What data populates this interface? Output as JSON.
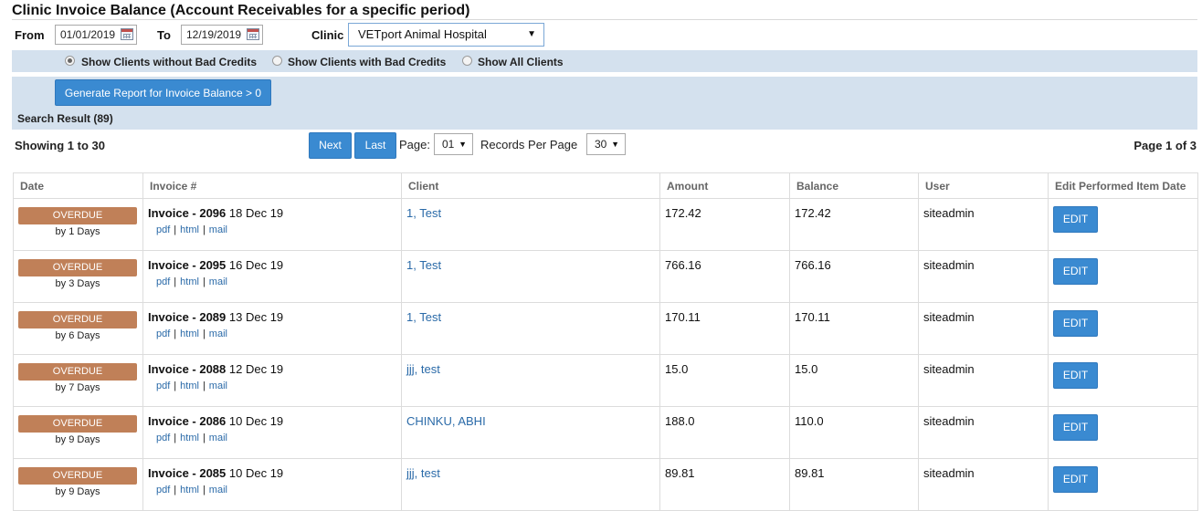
{
  "page": {
    "title": "Clinic Invoice Balance (Account Receivables for a specific period)"
  },
  "filters": {
    "from_label": "From",
    "from_value": "01/01/2019",
    "to_label": "To",
    "to_value": "12/19/2019",
    "clinic_label": "Clinic",
    "clinic_value": "VETport Animal Hospital"
  },
  "credit_options": [
    {
      "label": "Show Clients without Bad Credits",
      "selected": true
    },
    {
      "label": "Show Clients with Bad Credits",
      "selected": false
    },
    {
      "label": "Show All Clients",
      "selected": false
    }
  ],
  "generate_button": "Generate Report for Invoice Balance > 0",
  "search_result": "Search Result (89)",
  "pagination": {
    "showing": "Showing 1 to 30",
    "next_label": "Next",
    "last_label": "Last",
    "page_label": "Page:",
    "page_value": "01",
    "records_label": "Records Per Page",
    "records_value": "30",
    "page_of": "Page 1 of 3"
  },
  "table": {
    "columns": [
      "Date",
      "Invoice #",
      "Client",
      "Amount",
      "Balance",
      "User",
      "Edit Performed Item Date"
    ],
    "rows": [
      {
        "status": "OVERDUE",
        "days": "by 1 Days",
        "invoice": "Invoice - 2096",
        "inv_date": " 18 Dec 19",
        "client": "1, Test",
        "amount": "172.42",
        "balance": "172.42",
        "user": "siteadmin",
        "edit": "EDIT"
      },
      {
        "status": "OVERDUE",
        "days": "by 3 Days",
        "invoice": "Invoice - 2095",
        "inv_date": " 16 Dec 19",
        "client": "1, Test",
        "amount": "766.16",
        "balance": "766.16",
        "user": "siteadmin",
        "edit": "EDIT"
      },
      {
        "status": "OVERDUE",
        "days": "by 6 Days",
        "invoice": "Invoice - 2089",
        "inv_date": " 13 Dec 19",
        "client": "1, Test",
        "amount": "170.11",
        "balance": "170.11",
        "user": "siteadmin",
        "edit": "EDIT"
      },
      {
        "status": "OVERDUE",
        "days": "by 7 Days",
        "invoice": "Invoice - 2088",
        "inv_date": " 12 Dec 19",
        "client": "jjj, test",
        "amount": "15.0",
        "balance": "15.0",
        "user": "siteadmin",
        "edit": "EDIT"
      },
      {
        "status": "OVERDUE",
        "days": "by 9 Days",
        "invoice": "Invoice - 2086",
        "inv_date": " 10 Dec 19",
        "client": "CHINKU, ABHI",
        "amount": "188.0",
        "balance": "110.0",
        "user": "siteadmin",
        "edit": "EDIT"
      },
      {
        "status": "OVERDUE",
        "days": "by 9 Days",
        "invoice": "Invoice - 2085",
        "inv_date": " 10 Dec 19",
        "client": "jjj, test",
        "amount": "89.81",
        "balance": "89.81",
        "user": "siteadmin",
        "edit": "EDIT"
      }
    ],
    "link_labels": {
      "pdf": "pdf",
      "html": "html",
      "mail": "mail",
      "separator": "|"
    }
  },
  "colors": {
    "band": "#d4e1ee",
    "button": "#3a8ad1",
    "overdue_badge": "#c08058",
    "link": "#2a6aa8"
  }
}
